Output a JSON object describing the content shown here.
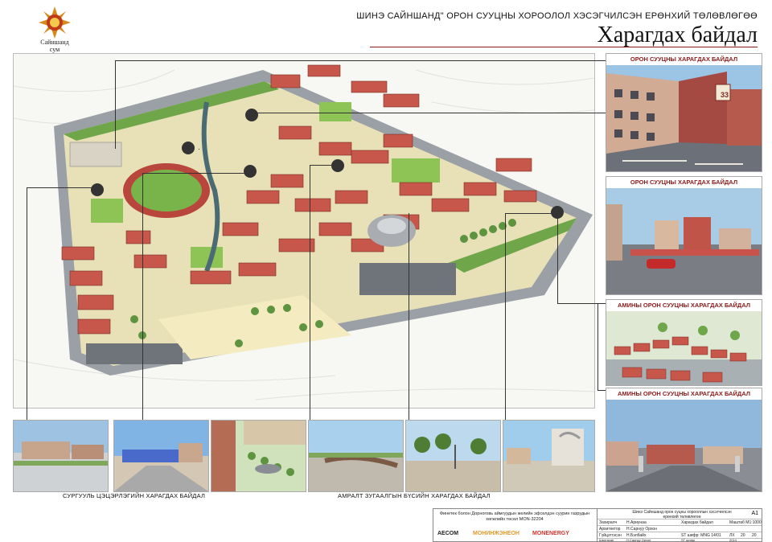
{
  "header": {
    "project_title": "ШИНЭ САЙНШАНД\" ОРОН СУУЦНЫ ХОРООЛОЛ  ХЭСЭГЧИЛСЭН ЕРӨНХИЙ ТӨЛӨВЛӨГӨӨ",
    "sheet_title": "Харагдах байдал"
  },
  "logo": {
    "caption_line1": "Сайншанд",
    "caption_line2": "сум",
    "icon": "sun-emblem-icon"
  },
  "right_views": [
    {
      "caption": "ОРОН СУУЦНЫ ХАРАГДАХ БАЙДАЛ",
      "badge": "33"
    },
    {
      "caption": "ОРОН СУУЦНЫ ХАРАГДАХ БАЙДАЛ"
    },
    {
      "caption": "АМИНЫ ОРОН СУУЦНЫ ХАРАГДАХ БАЙДАЛ"
    },
    {
      "caption": "АМИНЫ ОРОН СУУЦНЫ ХАРАГДАХ БАЙДАЛ"
    }
  ],
  "bottom_captions": {
    "school": "СУРГУУЛЬ ЦЭЦЭРЛЭГИЙН ХАРАГДАХ БАЙДАЛ",
    "recreation": "АМРАЛТ ЗУГААЛГЫН БҮСИЙН ХАРАГДАХ БАЙДАЛ"
  },
  "footer": {
    "description": "Финетек болон Дорноговь аймгуудын желийн эфсөлдэн суурин газрудын хөгжлийн төсөл MON-32204",
    "brands": [
      "AECOM",
      "МОНИНЖЭНЕОН",
      "MONENERGY"
    ],
    "title_block": {
      "heading": "Шинэ Сайншанд орон суцны хорооллын хэсэгчилсэн ерөнхий төлөвлөгөө",
      "sheet_label": "Харагдах байдал",
      "sheet_no": "A1",
      "rows": [
        {
          "role": "Захиралч",
          "name": "Н.Ариунаа"
        },
        {
          "role": "Архитектор",
          "name": "Н.Сарнуу Орхон"
        },
        {
          "role": "Гүйцэтгэсэн",
          "name": "Н.Бэлбайх"
        },
        {
          "role": "Шалгасан",
          "name": "Н.Сарнуу Орхон"
        }
      ],
      "codes": [
        "Маштаб М1:1000",
        "ST шифр: MNG 14/01",
        "ST шифр"
      ],
      "cols": [
        "ЛХ",
        "20",
        "20"
      ],
      "year": "2014"
    }
  },
  "colors": {
    "accent": "#8b1a1a",
    "roof": "#c6574a",
    "grass": "#8dc455",
    "road": "#8f949a",
    "plaza": "#f1e7b6"
  }
}
